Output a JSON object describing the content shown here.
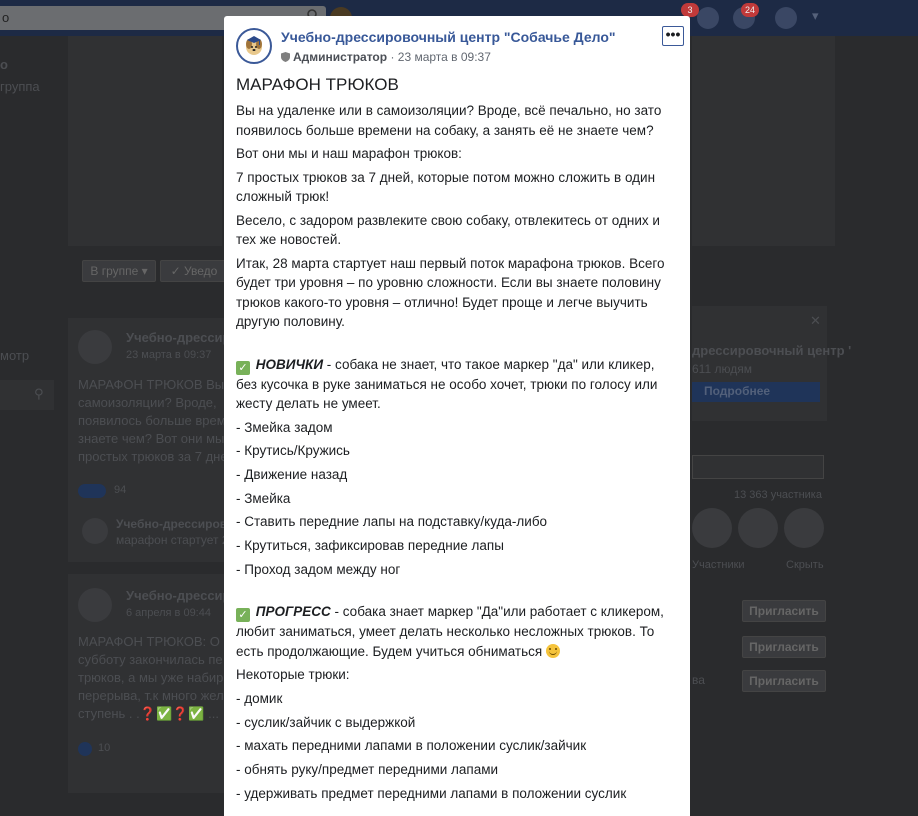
{
  "background": {
    "search_value": "о",
    "notifications_badge": "3",
    "notifications_badge_2": "24",
    "left_col": {
      "title_fragment": "о",
      "subtitle_fragment": "группа",
      "menu_fragment": "мотр"
    },
    "filter_bar": {
      "in_group": "В группе ▾",
      "notify": "✓ Уведо"
    },
    "feed_posts": [
      {
        "author": "Учебно-дрессиров",
        "date": "23 марта в 09:37",
        "text_lines": [
          "МАРАФОН ТРЮКОВ Вы",
          "самоизоляции? Вроде,",
          "появилось больше врем",
          "знаете чем? Вот они мы",
          "простых трюков за 7 дне"
        ],
        "reactions_count": "94",
        "comment_author": "Учебно-дрессиров",
        "comment_text": "марафон стартует 2"
      },
      {
        "author": "Учебно-дрессиров",
        "date": "6 апреля в 09:44",
        "text_lines": [
          "МАРАФОН ТРЮКОВ: О",
          "субботу закончилась пе",
          "трюков, а мы уже набир",
          "перерыва, т.к много жел",
          "ступень . .❓✅❓✅ ..."
        ],
        "reactions_count": "10"
      }
    ],
    "right_col": {
      "group_name": "дрессировочный центр '",
      "members_short": "611 людям",
      "more_button": "Подробнее",
      "members_count": "13 363 участника",
      "links": [
        "Участники",
        "Скрыть"
      ],
      "invite_buttons": [
        "Пригласить",
        "Пригласить",
        "Пригласить"
      ],
      "side_words": [
        "ва"
      ]
    }
  },
  "post": {
    "page_name": "Учебно-дрессировочный центр \"Собачье Дело\"",
    "role": "Администратор",
    "date": " · 23 марта в 09:37",
    "title": "МАРАФОН ТРЮКОВ",
    "intro": [
      "Вы на удаленке или в самоизоляции? Вроде, всё печально, но зато появилось больше времени на собаку, а занять её не знаете чем?",
      "Вот они мы и наш марафон трюков:",
      "7 простых трюков за 7 дней, которые потом можно сложить в один сложный трюк!",
      "Весело, с задором развлеките свою собаку, отвлекитесь от одних и тех же новостей.",
      "Итак, 28 марта стартует наш первый поток марафона трюков. Всего будет три уровня – по уровню сложности. Если вы знаете половину трюков какого-то уровня – отлично! Будет проще и легче выучить другую половину."
    ],
    "level1": {
      "name": "НОВИЧКИ",
      "description": " - собака не знает, что такое маркер \"да\" или кликер, без кусочка в руке заниматься не особо хочет, трюки по голосу или жесту делать не умеет.",
      "items": [
        "- Змейка задом",
        "- Крутись/Кружись",
        "- Движение назад",
        "- Змейка",
        "- Ставить передние лапы на подставку/куда-либо",
        "- Крутиться, зафиксировав передние лапы",
        "- Проход задом между ног"
      ]
    },
    "level2": {
      "name": "ПРОГРЕСС",
      "description": " - собака знает маркер \"Да\"или работает с кликером, любит заниматься, умеет делать несколько несложных трюков. То есть продолжающие. Будем учиться обниматься ",
      "tricks_heading": "Некоторые трюки:",
      "items": [
        "- домик",
        "- суслик/зайчик с выдержкой",
        "- махать передними лапами в положении суслик/зайчик",
        "- обнять руку/предмет передними лапами",
        "- удерживать предмет передними лапами в положении суслик"
      ]
    },
    "check_mark": "✓",
    "more_menu": "•••"
  }
}
